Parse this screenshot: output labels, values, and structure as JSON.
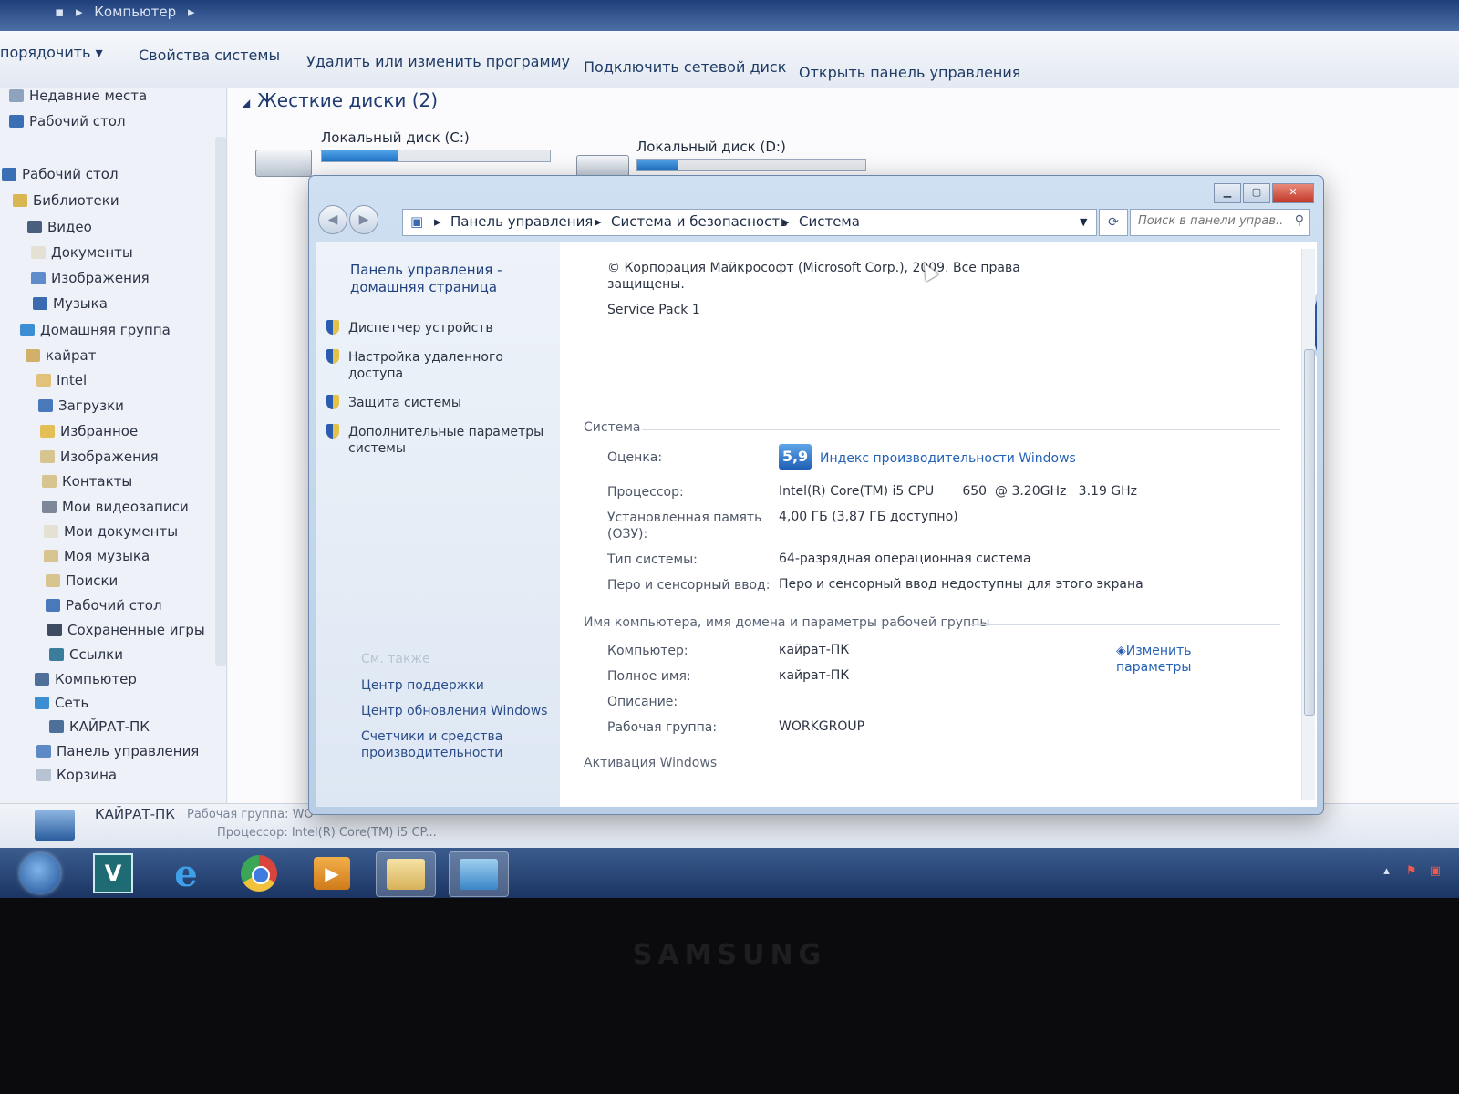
{
  "explorer": {
    "address": [
      "Компьютер"
    ],
    "toolbar": [
      "порядочить ▾",
      "Свойства системы",
      "Удалить или изменить программу",
      "Подключить сетевой диск",
      "Открыть панель управления"
    ],
    "nav": [
      "Недавние места",
      "Рабочий стол",
      "Рабочий стол",
      "Библиотеки",
      "Видео",
      "Документы",
      "Изображения",
      "Музыка",
      "Домашняя группа",
      "кайрат",
      "Intel",
      "Загрузки",
      "Избранное",
      "Изображения",
      "Контакты",
      "Мои видеозаписи",
      "Мои документы",
      "Моя музыка",
      "Поиски",
      "Рабочий стол",
      "Сохраненные игры",
      "Ссылки",
      "Компьютер",
      "Сеть",
      "КАЙРАТ-ПК",
      "Панель управления",
      "Корзина"
    ],
    "section_title": "Жесткие диски (2)",
    "drives": [
      {
        "name": "Локальный диск (C:)",
        "used_fraction": 0.33
      },
      {
        "name": "Локальный диск (D:)",
        "used_fraction": 0.18
      }
    ],
    "status": {
      "computer_name": "КАЙРАТ-ПК",
      "workgroup": "Рабочая группа: WO",
      "processor": "Процессор: Intel(R) Core(TM) i5 CP..."
    }
  },
  "taskbar": {
    "apps": [
      "start",
      "V",
      "e",
      "chrome",
      "media",
      "explorer",
      "control-panel"
    ]
  },
  "system_window": {
    "address": [
      "Панель управления",
      "Система и безопасность",
      "Система"
    ],
    "search_placeholder": "Поиск в панели управ...",
    "left_home": "Панель управления - домашняя страница",
    "tasks": [
      "Диспетчер устройств",
      "Настройка удаленного доступа",
      "Защита системы",
      "Дополнительные параметры системы"
    ],
    "see_also_title": "См. также",
    "see_also": [
      "Центр поддержки",
      "Центр обновления Windows",
      "Счетчики и средства производительности"
    ],
    "copyright": "© Корпорация Майкрософт (Microsoft Corp.), 2009. Все права защищены.",
    "service_pack": "Service Pack 1",
    "system_section": "Система",
    "rating_label": "Оценка:",
    "rating_value": "5,9",
    "rating_link": "Индекс производительности Windows",
    "processor_label": "Процессор:",
    "processor_value": "Intel(R) Core(TM) i5 CPU       650  @ 3.20GHz   3.19 GHz",
    "ram_label": "Установленная память (ОЗУ):",
    "ram_value": "4,00 ГБ (3,87 ГБ доступно)",
    "systype_label": "Тип системы:",
    "systype_value": "64-разрядная операционная система",
    "pen_label": "Перо и сенсорный ввод:",
    "pen_value": "Перо и сенсорный ввод недоступны для этого экрана",
    "computer_section": "Имя компьютера, имя домена и параметры рабочей группы",
    "computer_label": "Компьютер:",
    "computer_value": "кайрат-ПК",
    "fullname_label": "Полное имя:",
    "fullname_value": "кайрат-ПК",
    "description_label": "Описание:",
    "workgroup_label": "Рабочая группа:",
    "workgroup_value": "WORKGROUP",
    "change_link": "Изменить параметры",
    "activation_section": "Активация Windows"
  },
  "monitor_brand": "SAMSUNG"
}
